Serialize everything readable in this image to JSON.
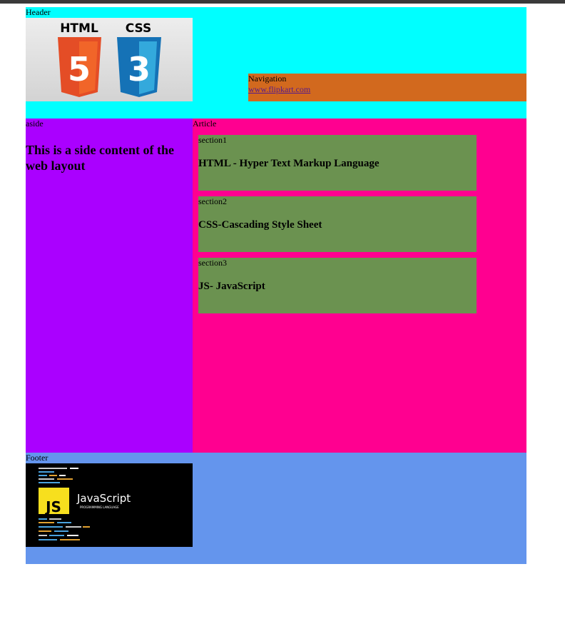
{
  "header": {
    "label": "Header",
    "logo_html_text": "HTML",
    "logo_css_text": "CSS",
    "logo_html_number": "5",
    "logo_css_number": "3"
  },
  "nav": {
    "label": "Navigation",
    "link_text": "www.flipkart.com"
  },
  "aside": {
    "label": "aside",
    "heading": "This is a side content of the web layout"
  },
  "article": {
    "label": "Article",
    "sections": [
      {
        "label": "section1",
        "heading": "HTML - Hyper Text Markup Language"
      },
      {
        "label": "section2",
        "heading": "CSS-Cascading Style Sheet"
      },
      {
        "label": "section3",
        "heading": "JS- JavaScript"
      }
    ]
  },
  "footer": {
    "label": "Footer",
    "js_badge": "JS",
    "js_title": "JavaScript",
    "js_subtitle": "PROGRAMMING LANGUAGE"
  },
  "colors": {
    "header_bg": "#00ffff",
    "nav_bg": "#d2691e",
    "aside_bg": "#aa00ff",
    "article_bg": "#ff0090",
    "section_bg": "#6b9250",
    "footer_bg": "#6495ed"
  }
}
